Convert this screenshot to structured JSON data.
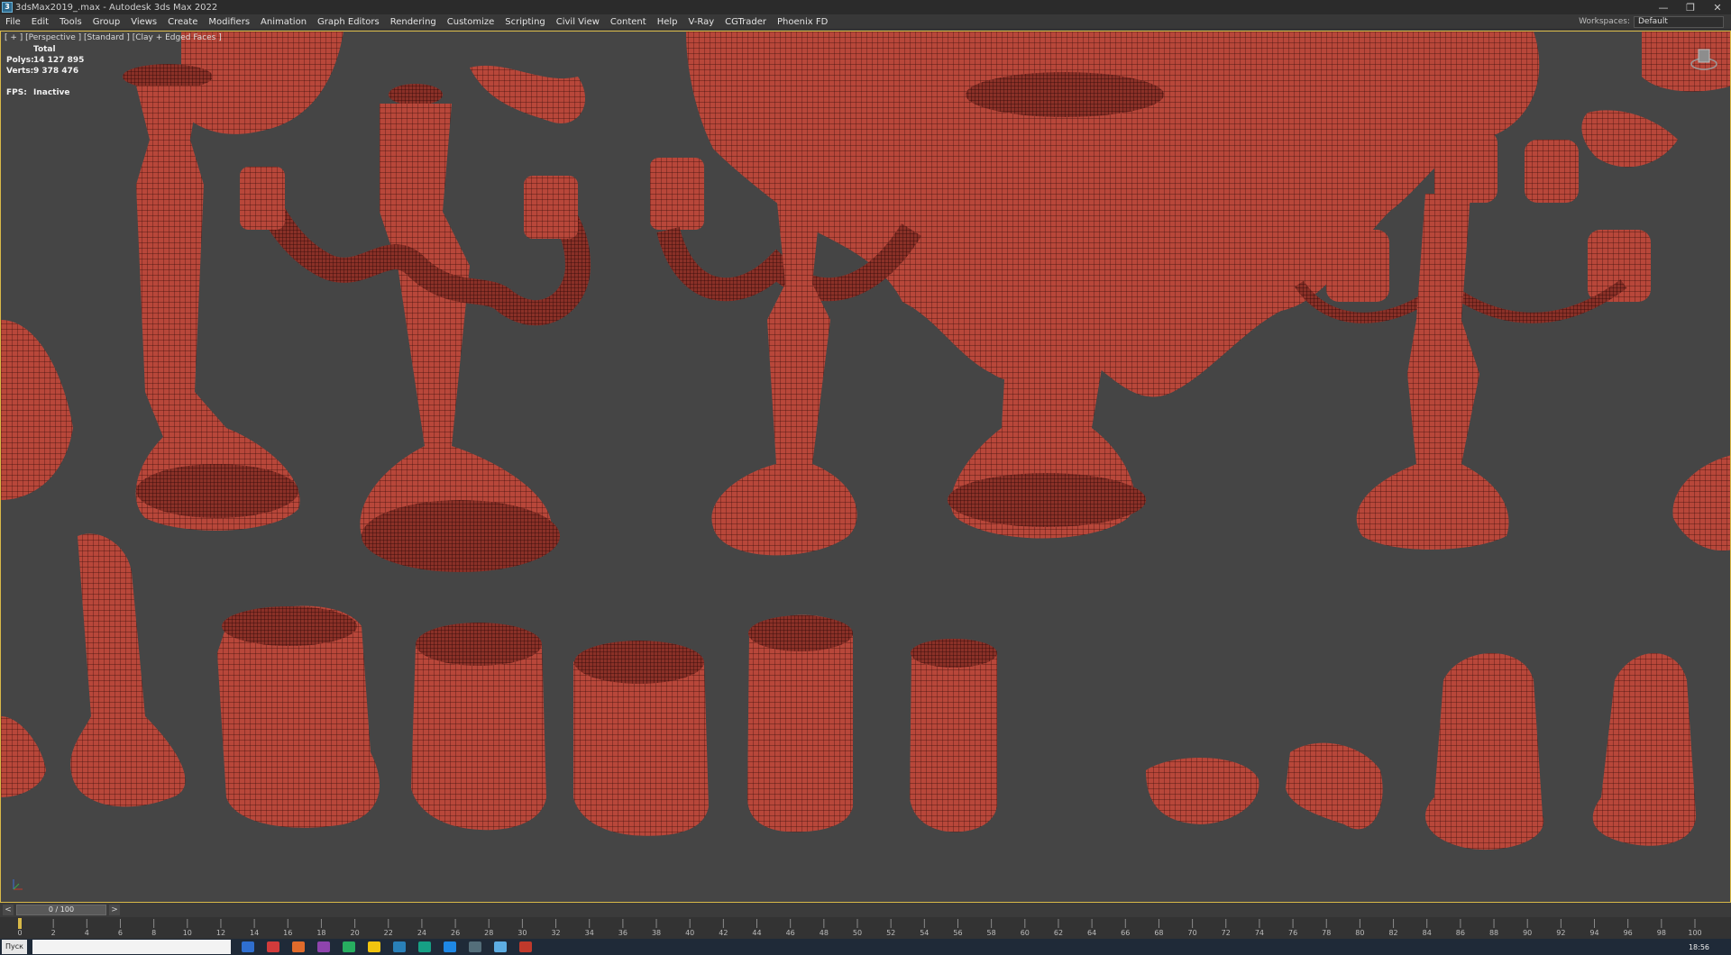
{
  "window": {
    "title": "3dsMax2019_.max - Autodesk 3ds Max 2022",
    "app_icon_glyph": "3",
    "controls": [
      "—",
      "❐",
      "✕"
    ]
  },
  "menu": {
    "items": [
      "File",
      "Edit",
      "Tools",
      "Group",
      "Views",
      "Create",
      "Modifiers",
      "Animation",
      "Graph Editors",
      "Rendering",
      "Customize",
      "Scripting",
      "Civil View",
      "Content",
      "Help",
      "V-Ray",
      "CGTrader",
      "Phoenix FD"
    ],
    "workspaces_label": "Workspaces:",
    "workspaces_value": "Default"
  },
  "viewport": {
    "label": "[ + ] [Perspective ] [Standard ] [Clay + Edged Faces ]",
    "stats": {
      "total_label": "Total",
      "polys_label": "Polys:",
      "polys_value": "14 127 895",
      "verts_label": "Verts:",
      "verts_value": "9 378 476",
      "fps_label": "FPS:",
      "fps_value": "Inactive"
    },
    "colors": {
      "background": "#454545",
      "model": "#b8473a",
      "model_dark": "#7c2a22",
      "wire": "#3a0e0b",
      "active_border": "#d8b948"
    }
  },
  "timeline": {
    "prev": "<",
    "next": ">",
    "frame_display": "0 / 100",
    "ticks": [
      "0",
      "2",
      "4",
      "6",
      "8",
      "10",
      "12",
      "14",
      "16",
      "18",
      "20",
      "22",
      "24",
      "26",
      "28",
      "30",
      "32",
      "34",
      "36",
      "38",
      "40",
      "42",
      "44",
      "46",
      "48",
      "50",
      "52",
      "54",
      "56",
      "58",
      "60",
      "62",
      "64",
      "66",
      "68",
      "70",
      "72",
      "74",
      "76",
      "78",
      "80",
      "82",
      "84",
      "86",
      "88",
      "90",
      "92",
      "94",
      "96",
      "98",
      "100"
    ]
  },
  "taskbar": {
    "start_label": "Пуск",
    "clock": "18:56"
  }
}
